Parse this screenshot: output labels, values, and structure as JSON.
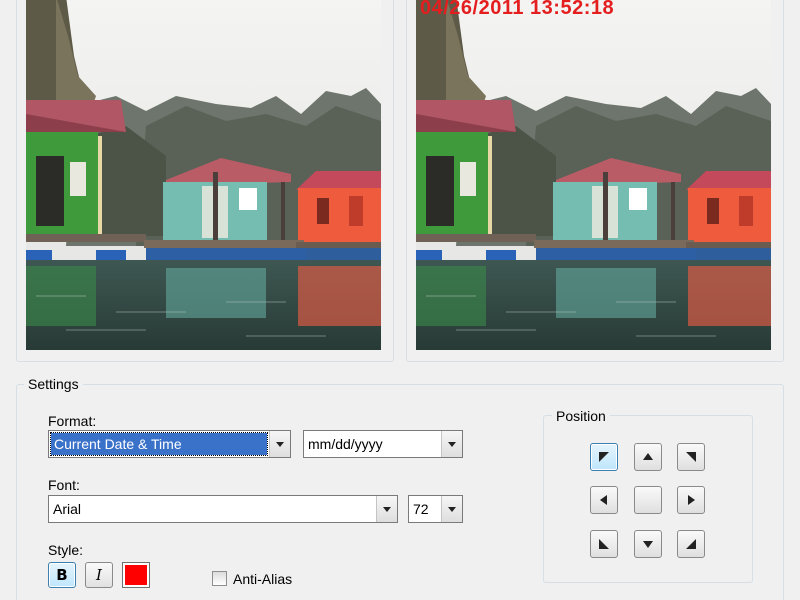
{
  "preview": {
    "timestamp": "04/26/2011 13:52:18",
    "stamp_color": "#e41e1e"
  },
  "settings": {
    "title": "Settings",
    "format": {
      "label": "Format:",
      "type_value": "Current Date & Time",
      "pattern_value": "mm/dd/yyyy"
    },
    "font": {
      "label": "Font:",
      "family_value": "Arial",
      "size_value": "72"
    },
    "style": {
      "label": "Style:",
      "bold_label": "B",
      "italic_label": "I",
      "bold_active": true,
      "italic_active": false,
      "text_color": "#ff0000"
    },
    "antialias": {
      "label": "Anti-Alias",
      "checked": false
    }
  },
  "position": {
    "title": "Position",
    "selected": "top-left",
    "buttons": [
      "top-left",
      "top-center",
      "top-right",
      "middle-left",
      "center",
      "middle-right",
      "bottom-left",
      "bottom-center",
      "bottom-right"
    ],
    "icons": [
      "arrow-up-left-icon",
      "arrow-up-icon",
      "arrow-up-right-icon",
      "arrow-left-icon",
      "blank-icon",
      "arrow-right-icon",
      "arrow-down-left-icon",
      "arrow-down-icon",
      "arrow-down-right-icon"
    ]
  },
  "colors": {
    "accent_selection": "#3a71c9",
    "active_button": "#bee6fd",
    "group_border": "#d5dfe5"
  }
}
